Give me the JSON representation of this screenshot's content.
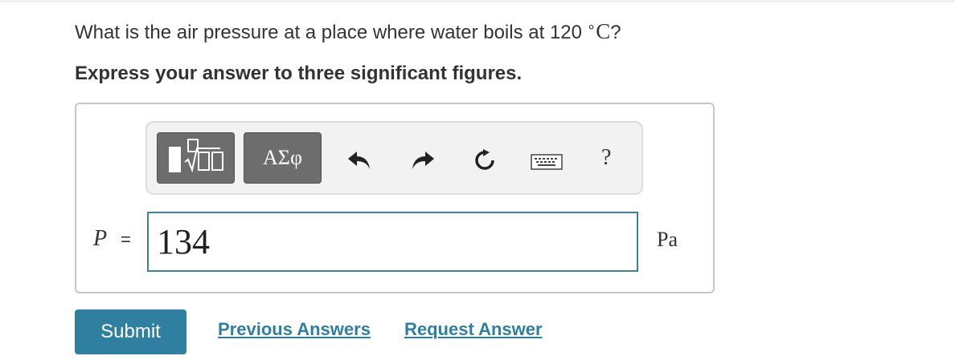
{
  "question": {
    "text": "What is the air pressure at a place where water boils at 120",
    "degree": "∘",
    "unit": "C",
    "suffix": "?"
  },
  "instruction": "Express your answer to three significant figures.",
  "toolbar": {
    "templates_icon": "templates-sqrt-icon",
    "greek_label": "ΑΣφ",
    "undo_icon": "undo-icon",
    "redo_icon": "redo-icon",
    "reset_icon": "reset-icon",
    "keyboard_icon": "keyboard-icon",
    "help_label": "?"
  },
  "answer": {
    "variable": "P",
    "equals": "=",
    "value": "134",
    "unit": "Pa"
  },
  "actions": {
    "submit_label": "Submit",
    "previous_answers_label": "Previous Answers",
    "request_answer_label": "Request Answer"
  },
  "colors": {
    "accent": "#2f7fa1",
    "input_border": "#3d7fa0",
    "toolbar_dark_button": "#6d6d6d"
  }
}
